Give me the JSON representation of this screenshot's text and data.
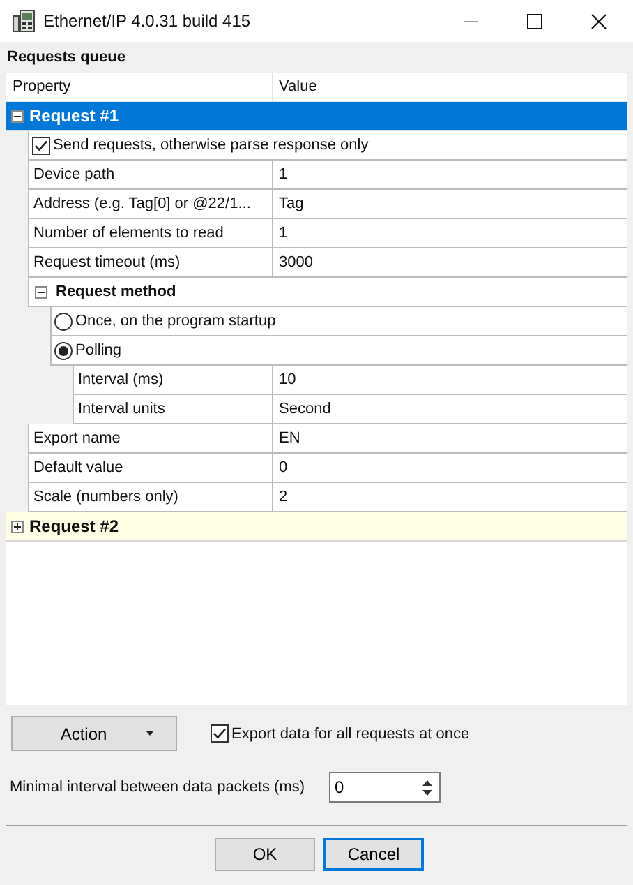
{
  "window": {
    "title": "Ethernet/IP 4.0.31 build 415"
  },
  "queue_label": "Requests queue",
  "grid": {
    "columns": [
      "Property",
      "Value"
    ],
    "sections": [
      {
        "title": "Request #1",
        "selected": true,
        "expanded": true,
        "items": [
          {
            "kind": "checkbox",
            "label": "Send requests, otherwise parse response only",
            "checked": true
          },
          {
            "kind": "property",
            "name": "Device path",
            "value": "1"
          },
          {
            "kind": "property",
            "name": "Address (e.g. Tag[0] or @22/1...",
            "value": "Tag"
          },
          {
            "kind": "property",
            "name": "Number of elements to read",
            "value": "1"
          },
          {
            "kind": "property",
            "name": "Request timeout (ms)",
            "value": "3000"
          },
          {
            "kind": "group",
            "title": "Request method",
            "expanded": true,
            "children": [
              {
                "kind": "radio",
                "label": "Once, on the program startup",
                "selected": false
              },
              {
                "kind": "radio",
                "label": "Polling",
                "selected": true,
                "children": [
                  {
                    "kind": "property",
                    "name": "Interval (ms)",
                    "value": "10"
                  },
                  {
                    "kind": "property",
                    "name": "Interval units",
                    "value": "Second"
                  }
                ]
              }
            ]
          },
          {
            "kind": "property",
            "name": "Export name",
            "value": "EN"
          },
          {
            "kind": "property",
            "name": "Default value",
            "value": "0"
          },
          {
            "kind": "property",
            "name": "Scale (numbers only)",
            "value": "2"
          }
        ]
      },
      {
        "title": "Request #2",
        "selected": false,
        "expanded": false
      }
    ]
  },
  "action_button": "Action",
  "export_all": {
    "label": "Export data for all requests at once",
    "checked": true
  },
  "min_interval": {
    "label": "Minimal interval between data packets (ms)",
    "value": "0"
  },
  "buttons": [
    {
      "label": "OK",
      "focused": false
    },
    {
      "label": "Cancel",
      "focused": true
    }
  ]
}
